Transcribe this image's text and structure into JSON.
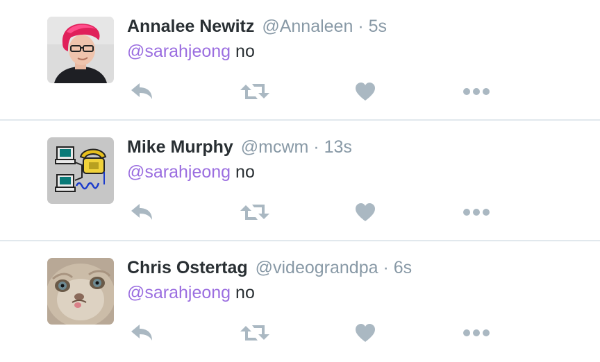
{
  "colors": {
    "text": "#292f33",
    "muted": "#8899a6",
    "mention": "#9b6ee0",
    "action_icon": "#aab8c2",
    "divider": "#e1e8ed"
  },
  "tweets": [
    {
      "fullname": "Annalee Newitz",
      "username": "@Annaleen",
      "separator": "·",
      "time": "5s",
      "mention": "@sarahjeong",
      "text": " no",
      "avatar_icon": "red-haired-person-avatar"
    },
    {
      "fullname": "Mike Murphy",
      "username": "@mcwm",
      "separator": "·",
      "time": "13s",
      "mention": "@sarahjeong",
      "text": " no",
      "avatar_icon": "dialup-networking-avatar"
    },
    {
      "fullname": "Chris Ostertag",
      "username": "@videograndpa",
      "separator": "·",
      "time": "6s",
      "mention": "@sarahjeong",
      "text": " no",
      "avatar_icon": "grumpy-cat-avatar"
    }
  ],
  "actions": [
    {
      "name": "reply-icon"
    },
    {
      "name": "retweet-icon"
    },
    {
      "name": "like-icon"
    },
    {
      "name": "more-icon"
    }
  ]
}
